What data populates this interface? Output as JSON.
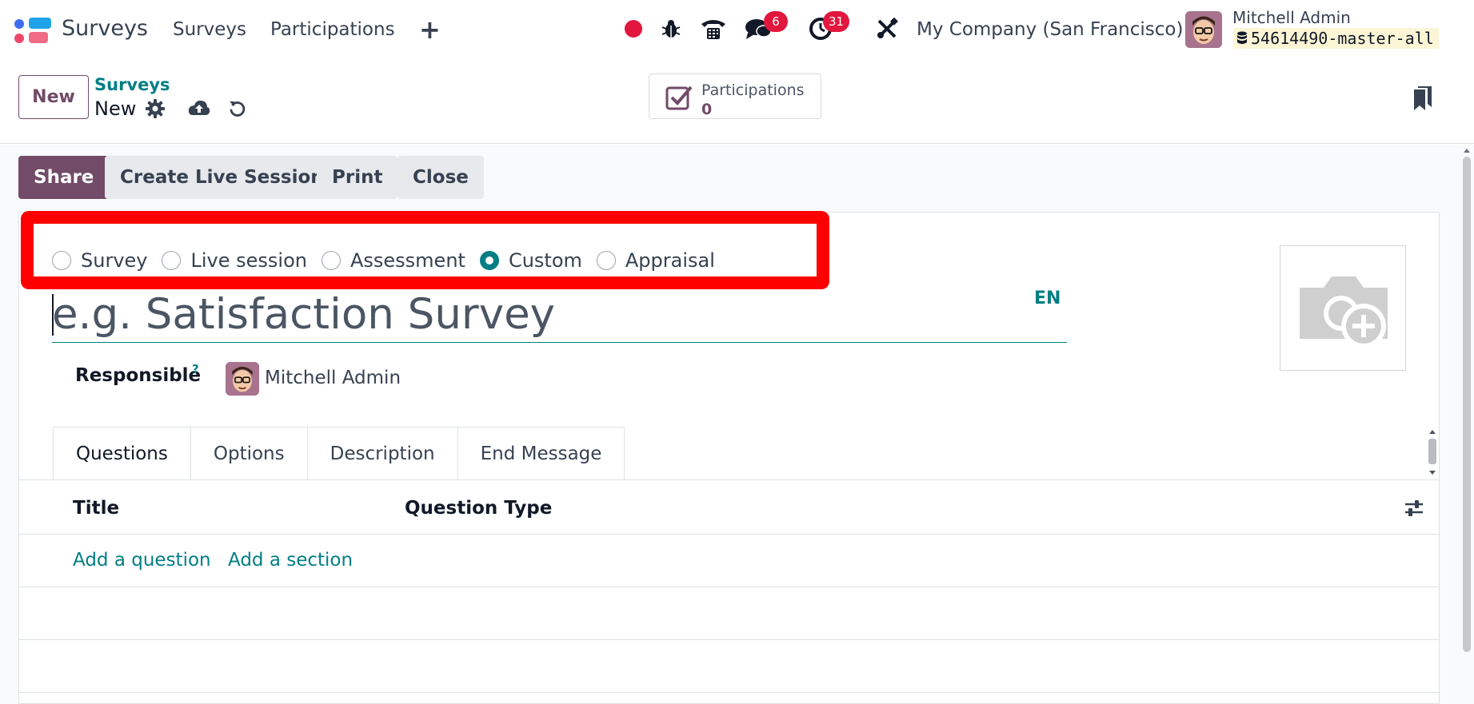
{
  "navbar": {
    "app_name": "Surveys",
    "menu": [
      "Surveys",
      "Participations"
    ],
    "plus": "+",
    "messages_count": "6",
    "activities_count": "31",
    "company": "My Company (San Francisco)",
    "user_name": "Mitchell Admin",
    "database": "54614490-master-all"
  },
  "control_panel": {
    "new_label": "New",
    "breadcrumb_parent": "Surveys",
    "breadcrumb_current": "New",
    "stat_label": "Participations",
    "stat_value": "0"
  },
  "status_buttons": {
    "share": "Share",
    "live": "Create Live Session",
    "print": "Print",
    "close": "Close"
  },
  "survey_type": {
    "options": [
      "Survey",
      "Live session",
      "Assessment",
      "Custom",
      "Appraisal"
    ],
    "selected": "Custom"
  },
  "form": {
    "title_placeholder": "e.g. Satisfaction Survey",
    "lang": "EN",
    "responsible_label": "Responsible",
    "responsible_help": "?",
    "responsible_name": "Mitchell Admin"
  },
  "tabs": [
    "Questions",
    "Options",
    "Description",
    "End Message"
  ],
  "table": {
    "columns": [
      "Title",
      "Question Type"
    ],
    "add_question": "Add a question",
    "add_section": "Add a section"
  },
  "colors": {
    "primary": "#714b67",
    "accent": "#017e84",
    "badge": "#e1173e",
    "highlight": "#ff0000"
  }
}
